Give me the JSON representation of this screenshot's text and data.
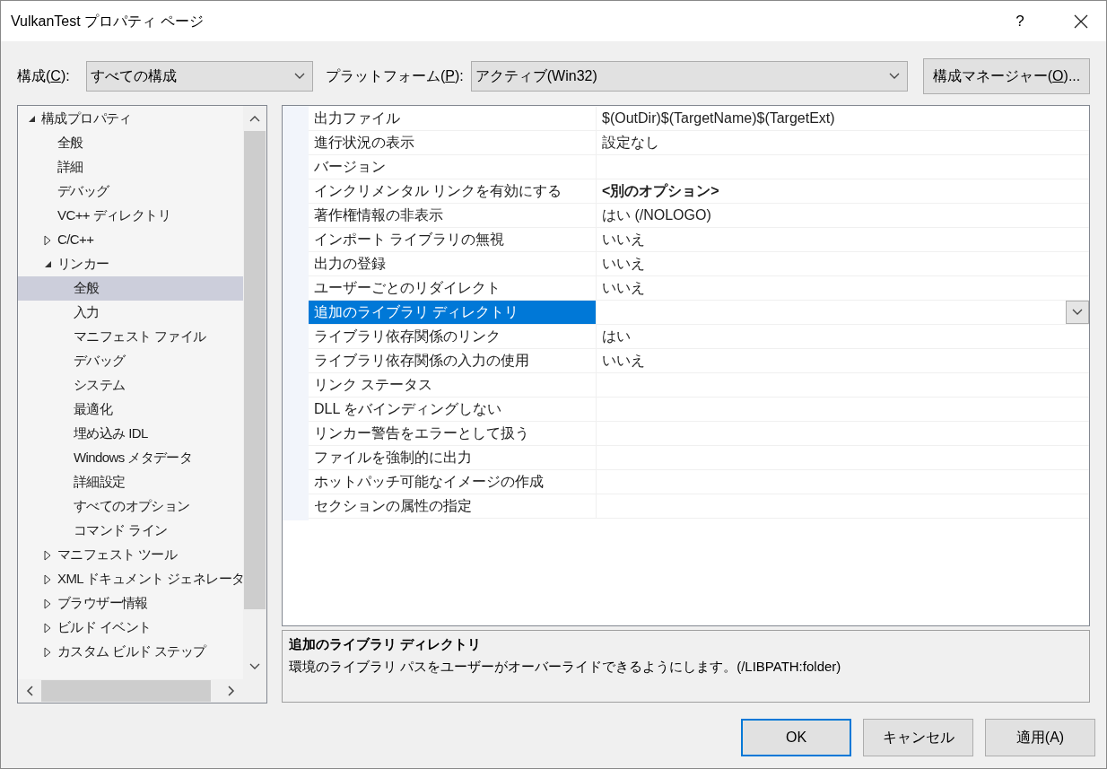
{
  "window": {
    "title": "VulkanTest プロパティ ページ",
    "help": "?"
  },
  "toolbar": {
    "configuration": {
      "label": {
        "before": "構成(",
        "key": "C",
        "after": "):"
      },
      "value": "すべての構成"
    },
    "platform": {
      "label": {
        "before": "プラットフォーム(",
        "key": "P",
        "after": "):"
      },
      "value": "アクティブ(Win32)"
    },
    "manager_button": {
      "before": "構成マネージャー(",
      "key": "O",
      "after": ")..."
    }
  },
  "tree": [
    {
      "label": "構成プロパティ",
      "expanded": true,
      "selected": false,
      "children": [
        {
          "label": "全般",
          "selected": false
        },
        {
          "label": "詳細",
          "selected": false
        },
        {
          "label": "デバッグ",
          "selected": false
        },
        {
          "label": "VC++ ディレクトリ",
          "selected": false
        },
        {
          "label": "C/C++",
          "expanded": false,
          "selected": false
        },
        {
          "label": "リンカー",
          "expanded": true,
          "selected": false,
          "children": [
            {
              "label": "全般",
              "selected": true
            },
            {
              "label": "入力",
              "selected": false
            },
            {
              "label": "マニフェスト ファイル",
              "selected": false
            },
            {
              "label": "デバッグ",
              "selected": false
            },
            {
              "label": "システム",
              "selected": false
            },
            {
              "label": "最適化",
              "selected": false
            },
            {
              "label": "埋め込み IDL",
              "selected": false
            },
            {
              "label": "Windows メタデータ",
              "selected": false
            },
            {
              "label": "詳細設定",
              "selected": false
            },
            {
              "label": "すべてのオプション",
              "selected": false
            },
            {
              "label": "コマンド ライン",
              "selected": false
            }
          ]
        },
        {
          "label": "マニフェスト ツール",
          "expanded": false,
          "selected": false
        },
        {
          "label": "XML ドキュメント ジェネレータ",
          "expanded": false,
          "selected": false
        },
        {
          "label": "ブラウザー情報",
          "expanded": false,
          "selected": false
        },
        {
          "label": "ビルド イベント",
          "expanded": false,
          "selected": false
        },
        {
          "label": "カスタム ビルド ステップ",
          "expanded": false,
          "selected": false
        }
      ]
    }
  ],
  "properties": [
    {
      "name": "出力ファイル",
      "value": "$(OutDir)$(TargetName)$(TargetExt)",
      "bold": false,
      "selected": false
    },
    {
      "name": "進行状況の表示",
      "value": "設定なし",
      "bold": false,
      "selected": false
    },
    {
      "name": "バージョン",
      "selected": false
    },
    {
      "name": "インクリメンタル リンクを有効にする",
      "value": "<別のオプション>",
      "bold": true,
      "selected": false
    },
    {
      "name": "著作権情報の非表示",
      "value": "はい (/NOLOGO)",
      "bold": false,
      "selected": false
    },
    {
      "name": "インポート ライブラリの無視",
      "value": "いいえ",
      "bold": false,
      "selected": false
    },
    {
      "name": "出力の登録",
      "value": "いいえ",
      "bold": false,
      "selected": false
    },
    {
      "name": "ユーザーごとのリダイレクト",
      "value": "いいえ",
      "bold": false,
      "selected": false
    },
    {
      "name": "追加のライブラリ ディレクトリ",
      "selected": true
    },
    {
      "name": "ライブラリ依存関係のリンク",
      "value": "はい",
      "bold": false,
      "selected": false
    },
    {
      "name": "ライブラリ依存関係の入力の使用",
      "value": "いいえ",
      "bold": false,
      "selected": false
    },
    {
      "name": "リンク ステータス",
      "selected": false
    },
    {
      "name": "DLL をバインディングしない",
      "selected": false
    },
    {
      "name": "リンカー警告をエラーとして扱う",
      "selected": false
    },
    {
      "name": "ファイルを強制的に出力",
      "selected": false
    },
    {
      "name": "ホットパッチ可能なイメージの作成",
      "selected": false
    },
    {
      "name": "セクションの属性の指定",
      "selected": false
    }
  ],
  "description": {
    "title": "追加のライブラリ ディレクトリ",
    "text": "環境のライブラリ パスをユーザーがオーバーライドできるようにします。(/LIBPATH:folder)"
  },
  "buttons": [
    {
      "label": "OK",
      "default": true
    },
    {
      "label": "キャンセル",
      "default": false
    },
    {
      "label": "適用(A)",
      "default": false
    }
  ]
}
